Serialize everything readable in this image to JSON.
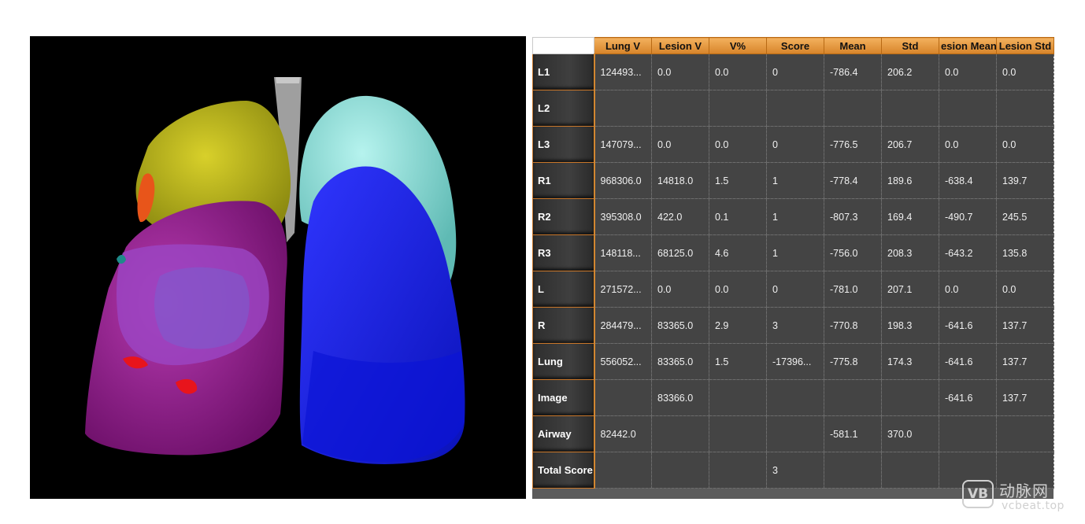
{
  "table": {
    "columns": [
      "Lung V",
      "Lesion V",
      "V%",
      "Score",
      "Mean",
      "Std",
      "esion Mean",
      "Lesion Std"
    ],
    "rows": [
      {
        "label": "L1",
        "cells": [
          "124493...",
          "0.0",
          "0.0",
          "0",
          "-786.4",
          "206.2",
          "0.0",
          "0.0"
        ]
      },
      {
        "label": "L2",
        "cells": [
          "",
          "",
          "",
          "",
          "",
          "",
          "",
          ""
        ]
      },
      {
        "label": "L3",
        "cells": [
          "147079...",
          "0.0",
          "0.0",
          "0",
          "-776.5",
          "206.7",
          "0.0",
          "0.0"
        ]
      },
      {
        "label": "R1",
        "cells": [
          "968306.0",
          "14818.0",
          "1.5",
          "1",
          "-778.4",
          "189.6",
          "-638.4",
          "139.7"
        ]
      },
      {
        "label": "R2",
        "cells": [
          "395308.0",
          "422.0",
          "0.1",
          "1",
          "-807.3",
          "169.4",
          "-490.7",
          "245.5"
        ]
      },
      {
        "label": "R3",
        "cells": [
          "148118...",
          "68125.0",
          "4.6",
          "1",
          "-756.0",
          "208.3",
          "-643.2",
          "135.8"
        ]
      },
      {
        "label": "L",
        "cells": [
          "271572...",
          "0.0",
          "0.0",
          "0",
          "-781.0",
          "207.1",
          "0.0",
          "0.0"
        ]
      },
      {
        "label": "R",
        "cells": [
          "284479...",
          "83365.0",
          "2.9",
          "3",
          "-770.8",
          "198.3",
          "-641.6",
          "137.7"
        ]
      },
      {
        "label": "Lung",
        "cells": [
          "556052...",
          "83365.0",
          "1.5",
          "-17396...",
          "-775.8",
          "174.3",
          "-641.6",
          "137.7"
        ]
      },
      {
        "label": "Image",
        "cells": [
          "",
          "83366.0",
          "",
          "",
          "",
          "",
          "-641.6",
          "137.7"
        ]
      },
      {
        "label": "Airway",
        "cells": [
          "82442.0",
          "",
          "",
          "",
          "-581.1",
          "370.0",
          "",
          ""
        ]
      },
      {
        "label": "Total Score",
        "cells": [
          "",
          "",
          "",
          "3",
          "",
          "",
          "",
          ""
        ]
      }
    ]
  },
  "watermark": {
    "logo": "VB",
    "name": "动脉网",
    "url": "vcbeat.top"
  },
  "colors": {
    "header_orange": "#e29a42",
    "cell_bg": "#444444",
    "lobe_yellow": "#c8c21a",
    "lobe_magenta": "#a2229e",
    "lobe_cyan": "#9ce8e2",
    "lobe_blue": "#1c24e6",
    "lesion_red": "#e8141c",
    "airway_gray": "#9a9a9a"
  }
}
